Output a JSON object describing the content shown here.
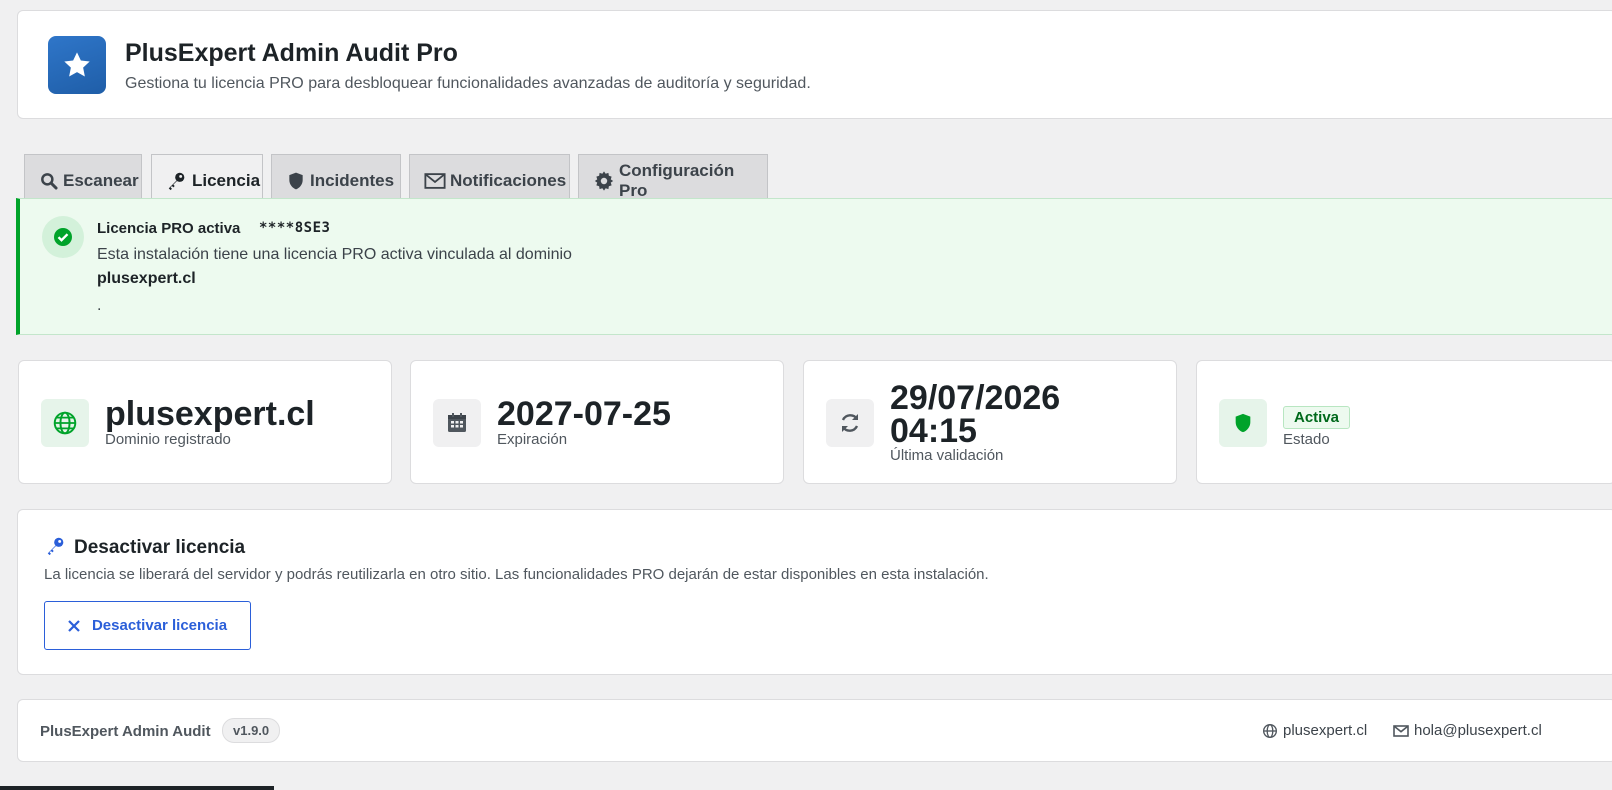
{
  "header": {
    "title": "PlusExpert Admin Audit Pro",
    "subtitle": "Gestiona tu licencia PRO para desbloquear funcionalidades avanzadas de auditoría y seguridad.",
    "logo_icon": "star-icon",
    "accent": "#2271b1"
  },
  "tabs": [
    {
      "label": "Escanear",
      "icon": "search-icon",
      "active": false
    },
    {
      "label": "Licencia",
      "icon": "key-icon",
      "active": true
    },
    {
      "label": "Incidentes",
      "icon": "shield-icon",
      "active": false
    },
    {
      "label": "Notificaciones",
      "icon": "envelope-icon",
      "active": false
    },
    {
      "label": "Configuración Pro",
      "icon": "gear-icon",
      "active": false
    }
  ],
  "notice": {
    "title": "Licencia PRO activa",
    "key": "****8SE3",
    "text": "Esta instalación tiene una licencia PRO activa vinculada al dominio",
    "domain": "plusexpert.cl",
    "suffix": ".",
    "color": "#00a32a"
  },
  "stats": [
    {
      "value": "plusexpert.cl",
      "label": "Dominio registrado",
      "icon": "globe-icon"
    },
    {
      "value": "2027-07-25",
      "label": "Expiración",
      "icon": "calendar-icon"
    },
    {
      "value_line1": "29/07/2026",
      "value_line2": "04:15",
      "label": "Última validación",
      "icon": "refresh-icon"
    },
    {
      "badge": "Activa",
      "label": "Estado",
      "icon": "shield-icon"
    }
  ],
  "deactivate": {
    "title": "Desactivar licencia",
    "description": "La licencia se liberará del servidor y podrás reutilizarla en otro sitio. Las funcionalidades PRO dejarán de estar disponibles en esta instalación.",
    "button_label": "Desactivar licencia",
    "button_color": "#2b5fd9"
  },
  "footer": {
    "name": "PlusExpert Admin Audit",
    "version": "v1.9.0",
    "website": "plusexpert.cl",
    "email": "hola@plusexpert.cl"
  }
}
